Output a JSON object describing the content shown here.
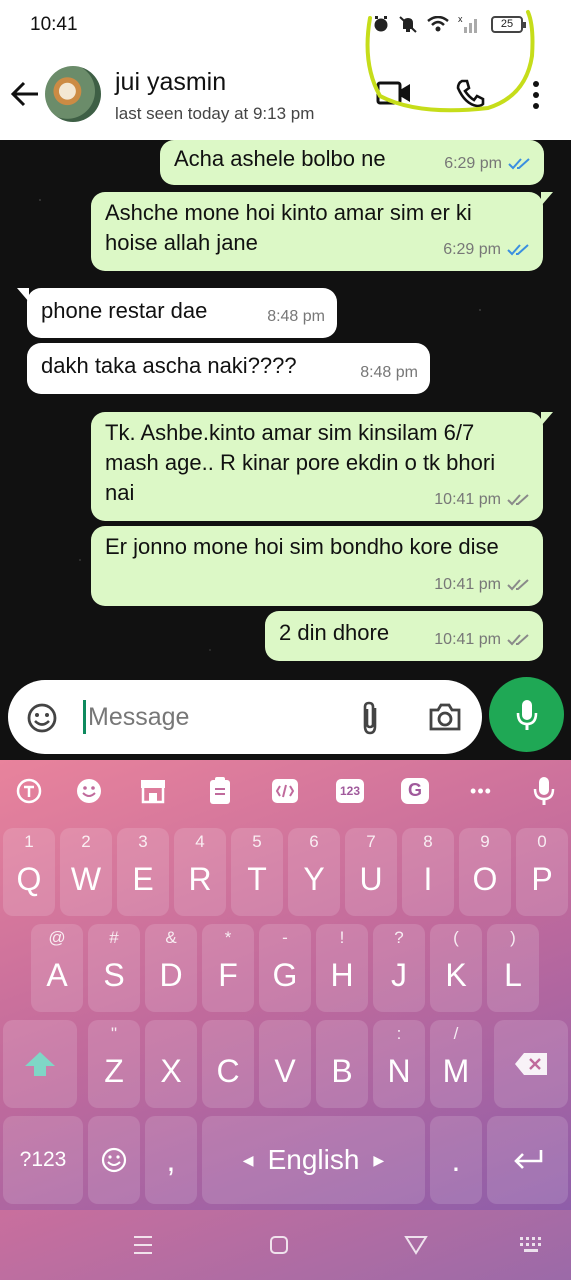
{
  "status_bar": {
    "time": "10:41",
    "battery": "25"
  },
  "header": {
    "contact_name": "jui yasmin",
    "last_seen": "last seen today at 9:13 pm"
  },
  "messages": [
    {
      "direction": "out",
      "text": "Acha ashele bolbo ne",
      "time": "6:29 pm",
      "status": "read"
    },
    {
      "direction": "out",
      "text": "Ashche mone hoi kinto amar sim er ki hoise allah jane",
      "time": "6:29 pm",
      "status": "read"
    },
    {
      "direction": "in",
      "text": "phone restar dae",
      "time": "8:48 pm"
    },
    {
      "direction": "in",
      "text": "dakh taka ascha naki????",
      "time": "8:48 pm"
    },
    {
      "direction": "out",
      "text": "Tk. Ashbe.kinto amar sim kinsilam 6/7 mash age.. R kinar pore ekdin o tk bhori nai",
      "time": "10:41 pm",
      "status": "delivered"
    },
    {
      "direction": "out",
      "text": "Er jonno mone hoi sim bondho kore dise",
      "time": "10:41 pm",
      "status": "delivered"
    },
    {
      "direction": "out",
      "text": "2 din dhore",
      "time": "10:41 pm",
      "status": "delivered"
    }
  ],
  "input": {
    "placeholder": "Message"
  },
  "keyboard": {
    "toolbar": [
      {
        "icon": "translate-icon"
      },
      {
        "icon": "emoji-icon"
      },
      {
        "icon": "store-icon"
      },
      {
        "icon": "clipboard-icon"
      },
      {
        "icon": "text-edit-icon"
      },
      {
        "icon": "numpad-icon",
        "label": "123"
      },
      {
        "icon": "grammar-icon",
        "label": "G"
      },
      {
        "icon": "more-dots-icon",
        "label": "•••"
      },
      {
        "icon": "voice-mic-icon"
      }
    ],
    "row1": [
      {
        "key": "Q",
        "hint": "1"
      },
      {
        "key": "W",
        "hint": "2"
      },
      {
        "key": "E",
        "hint": "3"
      },
      {
        "key": "R",
        "hint": "4"
      },
      {
        "key": "T",
        "hint": "5"
      },
      {
        "key": "Y",
        "hint": "6"
      },
      {
        "key": "U",
        "hint": "7"
      },
      {
        "key": "I",
        "hint": "8"
      },
      {
        "key": "O",
        "hint": "9"
      },
      {
        "key": "P",
        "hint": "0"
      }
    ],
    "row2": [
      {
        "key": "A",
        "hint": "@"
      },
      {
        "key": "S",
        "hint": "#"
      },
      {
        "key": "D",
        "hint": "&"
      },
      {
        "key": "F",
        "hint": "*"
      },
      {
        "key": "G",
        "hint": "-"
      },
      {
        "key": "H",
        "hint": "!"
      },
      {
        "key": "J",
        "hint": "?"
      },
      {
        "key": "K",
        "hint": "("
      },
      {
        "key": "L",
        "hint": ")"
      }
    ],
    "row3": [
      {
        "key": "Z",
        "hint": "\""
      },
      {
        "key": "X",
        "hint": ""
      },
      {
        "key": "C",
        "hint": ""
      },
      {
        "key": "V",
        "hint": ""
      },
      {
        "key": "B",
        "hint": ""
      },
      {
        "key": "N",
        "hint": ":"
      },
      {
        "key": "M",
        "hint": "/"
      }
    ],
    "symbols_label": "?123",
    "comma": ",",
    "space_label": "English",
    "period": "."
  },
  "colors": {
    "outgoing_bubble": "#dcf8c6",
    "incoming_bubble": "#ffffff",
    "accent_green": "#1fa855",
    "read_tick": "#3b8fe0",
    "annotation": "#c6dd1a"
  }
}
